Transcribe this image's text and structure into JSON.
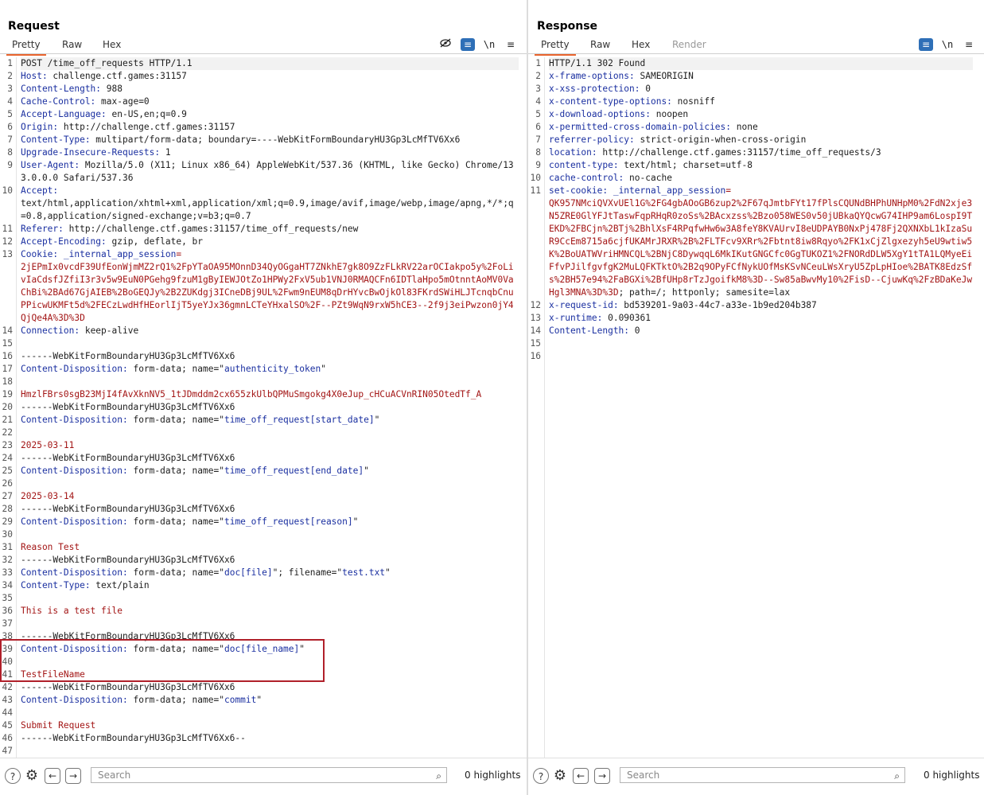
{
  "request": {
    "title": "Request",
    "tabs": [
      "Pretty",
      "Raw",
      "Hex"
    ],
    "active_tab": "Pretty",
    "search_placeholder": "Search",
    "highlights": "0 highlights",
    "lines": [
      {
        "n": "1",
        "parts": [
          {
            "t": "POST /time_off_requests HTTP/1.1",
            "c": "v"
          }
        ]
      },
      {
        "n": "2",
        "parts": [
          {
            "t": "Host: ",
            "c": "k"
          },
          {
            "t": "challenge.ctf.games:31157",
            "c": "v"
          }
        ]
      },
      {
        "n": "3",
        "parts": [
          {
            "t": "Content-Length: ",
            "c": "k"
          },
          {
            "t": "988",
            "c": "v"
          }
        ]
      },
      {
        "n": "4",
        "parts": [
          {
            "t": "Cache-Control: ",
            "c": "k"
          },
          {
            "t": "max-age=0",
            "c": "v"
          }
        ]
      },
      {
        "n": "5",
        "parts": [
          {
            "t": "Accept-Language: ",
            "c": "k"
          },
          {
            "t": "en-US,en;q=0.9",
            "c": "v"
          }
        ]
      },
      {
        "n": "6",
        "parts": [
          {
            "t": "Origin: ",
            "c": "k"
          },
          {
            "t": "http://challenge.ctf.games:31157",
            "c": "v"
          }
        ]
      },
      {
        "n": "7",
        "parts": [
          {
            "t": "Content-Type: ",
            "c": "k"
          },
          {
            "t": "multipart/form-data; boundary=----WebKitFormBoundaryHU3Gp3LcMfTV6Xx6",
            "c": "v"
          }
        ]
      },
      {
        "n": "8",
        "parts": [
          {
            "t": "Upgrade-Insecure-Requests: ",
            "c": "k"
          },
          {
            "t": "1",
            "c": "v"
          }
        ]
      },
      {
        "n": "9",
        "parts": [
          {
            "t": "User-Agent: ",
            "c": "k"
          },
          {
            "t": "Mozilla/5.0 (X11; Linux x86_64) AppleWebKit/537.36 (KHTML, like Gecko) Chrome/133.0.0.0 Safari/537.36",
            "c": "v"
          }
        ]
      },
      {
        "n": "10",
        "parts": [
          {
            "t": "Accept: ",
            "c": "k"
          },
          {
            "t": "\ntext/html,application/xhtml+xml,application/xml;q=0.9,image/avif,image/webp,image/apng,*/*;q=0.8,application/signed-exchange;v=b3;q=0.7",
            "c": "v"
          }
        ]
      },
      {
        "n": "11",
        "parts": [
          {
            "t": "Referer: ",
            "c": "k"
          },
          {
            "t": "http://challenge.ctf.games:31157/time_off_requests/new",
            "c": "v"
          }
        ]
      },
      {
        "n": "12",
        "parts": [
          {
            "t": "Accept-Encoding: ",
            "c": "k"
          },
          {
            "t": "gzip, deflate, br",
            "c": "v"
          }
        ]
      },
      {
        "n": "13",
        "parts": [
          {
            "t": "Cookie: ",
            "c": "k"
          },
          {
            "t": "_internal_app_session",
            "c": "k"
          },
          {
            "t": "=\n2jEPmIx0vcdF39UfEonWjmMZ2rQ1%2FpYTaOA95MOnnD34QyOGgaHT7ZNkhE7gk8O9ZzFLkRV22arOCIakpo5y%2FoLivIaCdsfJZfiI3r3v5w9EuN0PGehg9fzuM1gByIEWJOtZo1HPWy2FxV5ub1VNJ0RMAQCFn6IDTlaHpo5mOtnntAoMV0VaChBi%2BAd67GjAIEB%2BoGEQJy%2B2ZUKdgj3ICneDBj9UL%2Fwm9nEUM8qDrHYvcBwOjkOl83FKrdSWiHLJTcnqbCnuPPicwUKMFt5d%2FECzLwdHfHEorlIjT5yeYJx36gmnLCTeYHxalSO%2F--PZt9WqN9rxW5hCE3--2f9j3eiPwzon0jY4QjQe4A%3D%3D",
            "c": "r"
          }
        ]
      },
      {
        "n": "14",
        "parts": [
          {
            "t": "Connection: ",
            "c": "k"
          },
          {
            "t": "keep-alive",
            "c": "v"
          }
        ]
      },
      {
        "n": "15",
        "parts": []
      },
      {
        "n": "16",
        "parts": [
          {
            "t": "------WebKitFormBoundaryHU3Gp3LcMfTV6Xx6",
            "c": "v"
          }
        ]
      },
      {
        "n": "17",
        "parts": [
          {
            "t": "Content-Disposition: ",
            "c": "k"
          },
          {
            "t": "form-data; name=\"",
            "c": "v"
          },
          {
            "t": "authenticity_token",
            "c": "k"
          },
          {
            "t": "\"",
            "c": "v"
          }
        ]
      },
      {
        "n": "18",
        "parts": []
      },
      {
        "n": "19",
        "parts": [
          {
            "t": "HmzlFBrs0sgB23MjI4fAvXknNV5_1tJDmddm2cx655zkUlbQPMuSmgokg4X0eJup_cHCuACVnRIN05OtedTf_A",
            "c": "r"
          }
        ]
      },
      {
        "n": "20",
        "parts": [
          {
            "t": "------WebKitFormBoundaryHU3Gp3LcMfTV6Xx6",
            "c": "v"
          }
        ]
      },
      {
        "n": "21",
        "parts": [
          {
            "t": "Content-Disposition: ",
            "c": "k"
          },
          {
            "t": "form-data; name=\"",
            "c": "v"
          },
          {
            "t": "time_off_request[start_date]",
            "c": "k"
          },
          {
            "t": "\"",
            "c": "v"
          }
        ]
      },
      {
        "n": "22",
        "parts": []
      },
      {
        "n": "23",
        "parts": [
          {
            "t": "2025-03-11",
            "c": "r"
          }
        ]
      },
      {
        "n": "24",
        "parts": [
          {
            "t": "------WebKitFormBoundaryHU3Gp3LcMfTV6Xx6",
            "c": "v"
          }
        ]
      },
      {
        "n": "25",
        "parts": [
          {
            "t": "Content-Disposition: ",
            "c": "k"
          },
          {
            "t": "form-data; name=\"",
            "c": "v"
          },
          {
            "t": "time_off_request[end_date]",
            "c": "k"
          },
          {
            "t": "\"",
            "c": "v"
          }
        ]
      },
      {
        "n": "26",
        "parts": []
      },
      {
        "n": "27",
        "parts": [
          {
            "t": "2025-03-14",
            "c": "r"
          }
        ]
      },
      {
        "n": "28",
        "parts": [
          {
            "t": "------WebKitFormBoundaryHU3Gp3LcMfTV6Xx6",
            "c": "v"
          }
        ]
      },
      {
        "n": "29",
        "parts": [
          {
            "t": "Content-Disposition: ",
            "c": "k"
          },
          {
            "t": "form-data; name=\"",
            "c": "v"
          },
          {
            "t": "time_off_request[reason]",
            "c": "k"
          },
          {
            "t": "\"",
            "c": "v"
          }
        ]
      },
      {
        "n": "30",
        "parts": []
      },
      {
        "n": "31",
        "parts": [
          {
            "t": "Reason Test",
            "c": "r"
          }
        ]
      },
      {
        "n": "32",
        "parts": [
          {
            "t": "------WebKitFormBoundaryHU3Gp3LcMfTV6Xx6",
            "c": "v"
          }
        ]
      },
      {
        "n": "33",
        "parts": [
          {
            "t": "Content-Disposition: ",
            "c": "k"
          },
          {
            "t": "form-data; name=\"",
            "c": "v"
          },
          {
            "t": "doc[file]",
            "c": "k"
          },
          {
            "t": "\"; filename=\"",
            "c": "v"
          },
          {
            "t": "test.txt",
            "c": "k"
          },
          {
            "t": "\"",
            "c": "v"
          }
        ]
      },
      {
        "n": "34",
        "parts": [
          {
            "t": "Content-Type: ",
            "c": "k"
          },
          {
            "t": "text/plain",
            "c": "v"
          }
        ]
      },
      {
        "n": "35",
        "parts": []
      },
      {
        "n": "36",
        "parts": [
          {
            "t": "This is a test file",
            "c": "r"
          }
        ]
      },
      {
        "n": "37",
        "parts": []
      },
      {
        "n": "38",
        "parts": [
          {
            "t": "------WebKitFormBoundaryHU3Gp3LcMfTV6Xx6",
            "c": "v"
          }
        ]
      },
      {
        "n": "39",
        "parts": [
          {
            "t": "Content-Disposition: ",
            "c": "k"
          },
          {
            "t": "form-data; name=\"",
            "c": "v"
          },
          {
            "t": "doc[file_name]",
            "c": "k"
          },
          {
            "t": "\"",
            "c": "v"
          }
        ]
      },
      {
        "n": "40",
        "parts": []
      },
      {
        "n": "41",
        "parts": [
          {
            "t": "TestFileName",
            "c": "r"
          }
        ]
      },
      {
        "n": "42",
        "parts": [
          {
            "t": "------WebKitFormBoundaryHU3Gp3LcMfTV6Xx6",
            "c": "v"
          }
        ]
      },
      {
        "n": "43",
        "parts": [
          {
            "t": "Content-Disposition: ",
            "c": "k"
          },
          {
            "t": "form-data; name=\"",
            "c": "v"
          },
          {
            "t": "commit",
            "c": "k"
          },
          {
            "t": "\"",
            "c": "v"
          }
        ]
      },
      {
        "n": "44",
        "parts": []
      },
      {
        "n": "45",
        "parts": [
          {
            "t": "Submit Request",
            "c": "r"
          }
        ]
      },
      {
        "n": "46",
        "parts": [
          {
            "t": "------WebKitFormBoundaryHU3Gp3LcMfTV6Xx6--",
            "c": "v"
          }
        ]
      },
      {
        "n": "47",
        "parts": []
      }
    ]
  },
  "response": {
    "title": "Response",
    "tabs": [
      "Pretty",
      "Raw",
      "Hex",
      "Render"
    ],
    "active_tab": "Pretty",
    "search_placeholder": "Search",
    "highlights": "0 highlights",
    "lines": [
      {
        "n": "1",
        "parts": [
          {
            "t": "HTTP/1.1 302 Found",
            "c": "v"
          }
        ]
      },
      {
        "n": "2",
        "parts": [
          {
            "t": "x-frame-options: ",
            "c": "k"
          },
          {
            "t": "SAMEORIGIN",
            "c": "v"
          }
        ]
      },
      {
        "n": "3",
        "parts": [
          {
            "t": "x-xss-protection: ",
            "c": "k"
          },
          {
            "t": "0",
            "c": "v"
          }
        ]
      },
      {
        "n": "4",
        "parts": [
          {
            "t": "x-content-type-options: ",
            "c": "k"
          },
          {
            "t": "nosniff",
            "c": "v"
          }
        ]
      },
      {
        "n": "5",
        "parts": [
          {
            "t": "x-download-options: ",
            "c": "k"
          },
          {
            "t": "noopen",
            "c": "v"
          }
        ]
      },
      {
        "n": "6",
        "parts": [
          {
            "t": "x-permitted-cross-domain-policies: ",
            "c": "k"
          },
          {
            "t": "none",
            "c": "v"
          }
        ]
      },
      {
        "n": "7",
        "parts": [
          {
            "t": "referrer-policy: ",
            "c": "k"
          },
          {
            "t": "strict-origin-when-cross-origin",
            "c": "v"
          }
        ]
      },
      {
        "n": "8",
        "parts": [
          {
            "t": "location: ",
            "c": "k"
          },
          {
            "t": "http://challenge.ctf.games:31157/time_off_requests/3",
            "c": "v"
          }
        ]
      },
      {
        "n": "9",
        "parts": [
          {
            "t": "content-type: ",
            "c": "k"
          },
          {
            "t": "text/html; charset=utf-8",
            "c": "v"
          }
        ]
      },
      {
        "n": "10",
        "parts": [
          {
            "t": "cache-control: ",
            "c": "k"
          },
          {
            "t": "no-cache",
            "c": "v"
          }
        ]
      },
      {
        "n": "11",
        "parts": [
          {
            "t": "set-cookie: ",
            "c": "k"
          },
          {
            "t": "_internal_app_session",
            "c": "k"
          },
          {
            "t": "=\nQK957NMciQVXvUEl1G%2FG4gbAOoGB6zup2%2F67qJmtbFYt17fPlsCQUNdBHPhUNHpM0%2FdN2xje3N5ZRE0GlYFJtTaswFqpRHqR0zoSs%2BAcxzss%2Bzo058WES0v50jUBkaQYQcwG74IHP9am6LospI9TEKD%2FBCjn%2BTj%2BhlXsF4RPqfwHw6w3A8feY8KVAUrvI8eUDPAYB0NxPj478Fj2QXNXbL1kIzaSuR9CcEm8715a6cjfUKAMrJRXR%2B%2FLTFcv9XRr%2Fbtnt8iw8Rqyo%2FK1xCjZlgxezyh5eU9wtiw5K%2BoUATWVriHMNCQL%2BNjC8DywqqL6MkIKutGNGCfc0GgTUKOZ1%2FNORdDLW5XgY1tTA1LQMyeEiFfvPJilfgvfgK2MuLQFKTktO%2B2q9OPyFCfNykUOfMsKSvNCeuLWsXryU5ZpLpHIoe%2BATK8EdzSfs%2BH57e94%2FaBGXi%2BfUHp8rTzJgoifkM8%3D--Sw85aBwvMy10%2FisD--CjuwKq%2FzBDaKeJwHgl3MNA%3D%3D",
            "c": "r"
          },
          {
            "t": "; path=/; httponly; samesite=lax",
            "c": "v"
          }
        ]
      },
      {
        "n": "12",
        "parts": [
          {
            "t": "x-request-id: ",
            "c": "k"
          },
          {
            "t": "bd539201-9a03-44c7-a33e-1b9ed204b387",
            "c": "v"
          }
        ]
      },
      {
        "n": "13",
        "parts": [
          {
            "t": "x-runtime: ",
            "c": "k"
          },
          {
            "t": "0.090361",
            "c": "v"
          }
        ]
      },
      {
        "n": "14",
        "parts": [
          {
            "t": "Content-Length: ",
            "c": "k"
          },
          {
            "t": "0",
            "c": "v"
          }
        ]
      },
      {
        "n": "15",
        "parts": []
      },
      {
        "n": "16",
        "parts": []
      }
    ]
  }
}
